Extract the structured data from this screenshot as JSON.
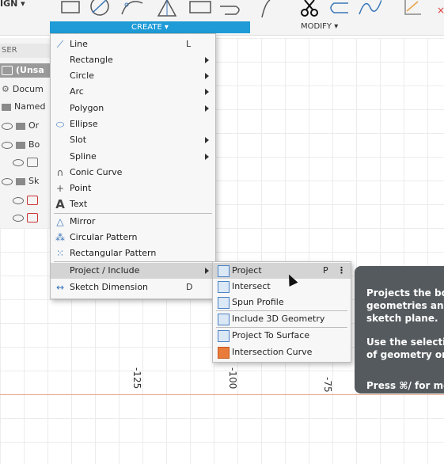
{
  "toolbar": {
    "design_label": "IGN ▾",
    "create_label": "CREATE ▾",
    "modify_label": "MODIFY ▾"
  },
  "browser": {
    "header": "SER",
    "rows": [
      {
        "label": "(Unsa",
        "highlight": true
      },
      {
        "label": "Docum"
      },
      {
        "label": "Named"
      },
      {
        "label": "Or"
      },
      {
        "label": "Bo"
      },
      {
        "label": ""
      },
      {
        "label": "Sk"
      },
      {
        "label": ""
      },
      {
        "label": ""
      }
    ]
  },
  "create_menu": {
    "items": [
      {
        "label": "Line",
        "shortcut": "L",
        "icon": "line-icon"
      },
      {
        "label": "Rectangle",
        "submenu": true
      },
      {
        "label": "Circle",
        "submenu": true
      },
      {
        "label": "Arc",
        "submenu": true
      },
      {
        "label": "Polygon",
        "submenu": true
      },
      {
        "label": "Ellipse",
        "icon": "ellipse-icon"
      },
      {
        "label": "Slot",
        "submenu": true
      },
      {
        "label": "Spline",
        "submenu": true
      },
      {
        "label": "Conic Curve",
        "icon": "conic-curve-icon"
      },
      {
        "label": "Point",
        "icon": "point-icon"
      },
      {
        "label": "Text",
        "icon": "text-icon"
      },
      {
        "label": "Mirror",
        "icon": "mirror-icon"
      },
      {
        "label": "Circular Pattern",
        "icon": "circular-pattern-icon"
      },
      {
        "label": "Rectangular Pattern",
        "icon": "rectangular-pattern-icon"
      },
      {
        "label": "Project / Include",
        "submenu": true,
        "selected": true
      },
      {
        "label": "Sketch Dimension",
        "shortcut": "D",
        "icon": "sketch-dimension-icon"
      }
    ]
  },
  "project_submenu": {
    "items": [
      {
        "label": "Project",
        "shortcut": "P",
        "selected": true
      },
      {
        "label": "Intersect"
      },
      {
        "label": "Spun Profile"
      },
      {
        "label": "Include 3D Geometry"
      },
      {
        "label": "Project To Surface"
      },
      {
        "label": "Intersection Curve"
      }
    ]
  },
  "tooltip": {
    "lines": [
      "Projects the bod",
      "geometries and",
      "sketch plane.",
      "",
      "Use the selection",
      "of geometry or t",
      "",
      "Press ⌘/ for mor"
    ]
  },
  "axis": {
    "ticks": [
      "-125",
      "-100",
      "-75"
    ]
  },
  "colors": {
    "accent": "#1f9bd7",
    "axis": "#e7a58a",
    "tooltip_bg": "#555a5e"
  }
}
